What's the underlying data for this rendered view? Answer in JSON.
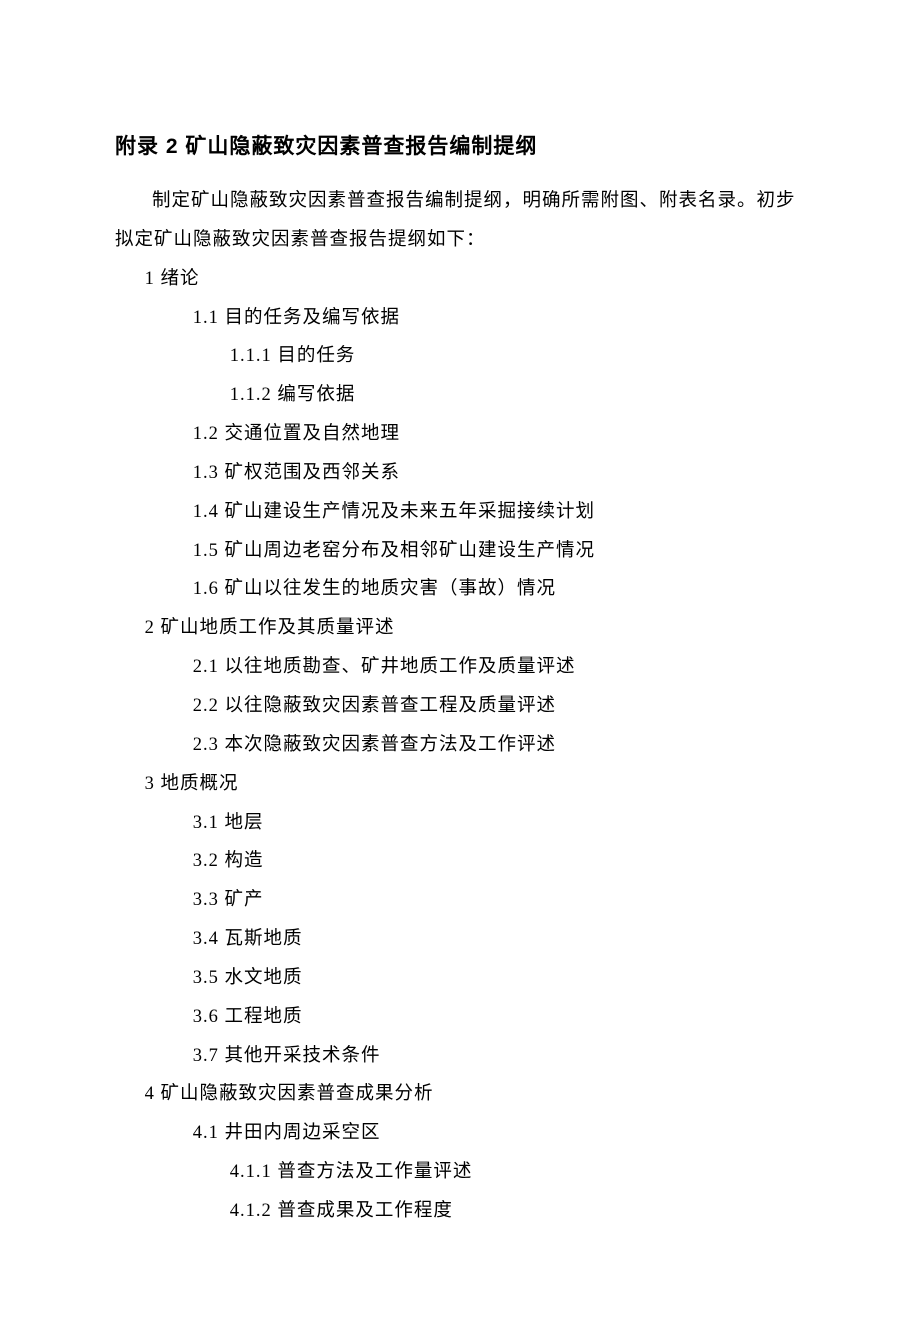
{
  "title": "附录 2 矿山隐蔽致灾因素普查报告编制提纲",
  "intro_p1": "制定矿山隐蔽致灾因素普查报告编制提纲，明确所需附图、附表名录。初步拟定矿山隐蔽致灾因素普查报告提纲如下：",
  "outline": {
    "s1": {
      "heading": "1 绪论",
      "i1_1": "1.1 目的任务及编写依据",
      "i1_1_1": "1.1.1 目的任务",
      "i1_1_2": "1.1.2 编写依据",
      "i1_2": "1.2 交通位置及自然地理",
      "i1_3": "1.3 矿权范围及西邻关系",
      "i1_4": "1.4 矿山建设生产情况及未来五年采掘接续计划",
      "i1_5": "1.5 矿山周边老窑分布及相邻矿山建设生产情况",
      "i1_6": "1.6 矿山以往发生的地质灾害（事故）情况"
    },
    "s2": {
      "heading": "2 矿山地质工作及其质量评述",
      "i2_1": "2.1 以往地质勘查、矿井地质工作及质量评述",
      "i2_2": "2.2 以往隐蔽致灾因素普查工程及质量评述",
      "i2_3": "2.3 本次隐蔽致灾因素普查方法及工作评述"
    },
    "s3": {
      "heading": "3 地质概况",
      "i3_1": "3.1 地层",
      "i3_2": "3.2 构造",
      "i3_3": "3.3 矿产",
      "i3_4": "3.4 瓦斯地质",
      "i3_5": "3.5 水文地质",
      "i3_6": "3.6 工程地质",
      "i3_7": "3.7 其他开采技术条件"
    },
    "s4": {
      "heading": "4 矿山隐蔽致灾因素普查成果分析",
      "i4_1": "4.1 井田内周边采空区",
      "i4_1_1": "4.1.1 普查方法及工作量评述",
      "i4_1_2": "4.1.2 普查成果及工作程度"
    }
  }
}
